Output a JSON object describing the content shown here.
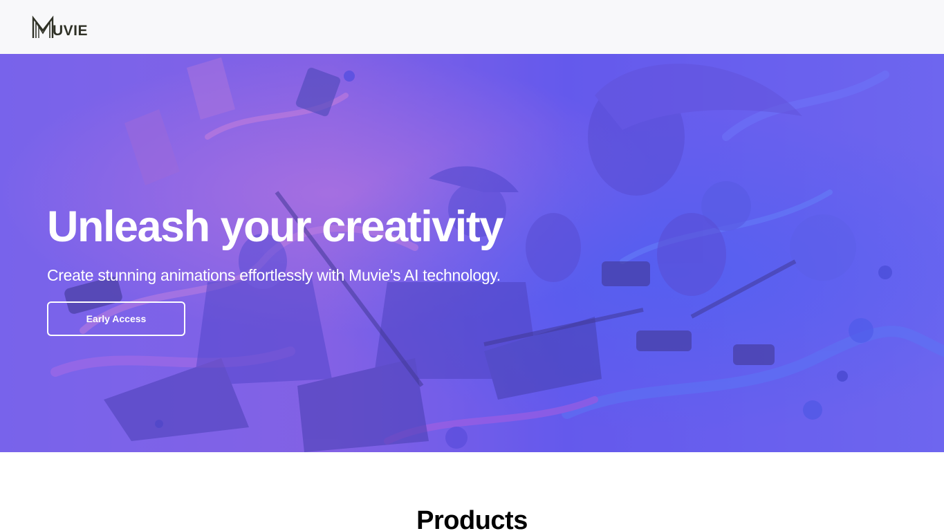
{
  "navbar": {
    "logo_text": "UVIE",
    "logo_icon": "muvie-m-logo-icon"
  },
  "hero": {
    "title": "Unleash your creativity",
    "subtitle": "Create stunning animations effortlessly with Muvie's AI technology.",
    "cta_label": "Early Access",
    "background_image": "animated characters with film cameras illustration",
    "overlay_color": "#6f63ec"
  },
  "products": {
    "title": "Products"
  },
  "colors": {
    "navbar_bg": "#f8f8fa",
    "logo_color": "#2f3126",
    "hero_text": "#ffffff",
    "page_bg": "#ffffff"
  }
}
